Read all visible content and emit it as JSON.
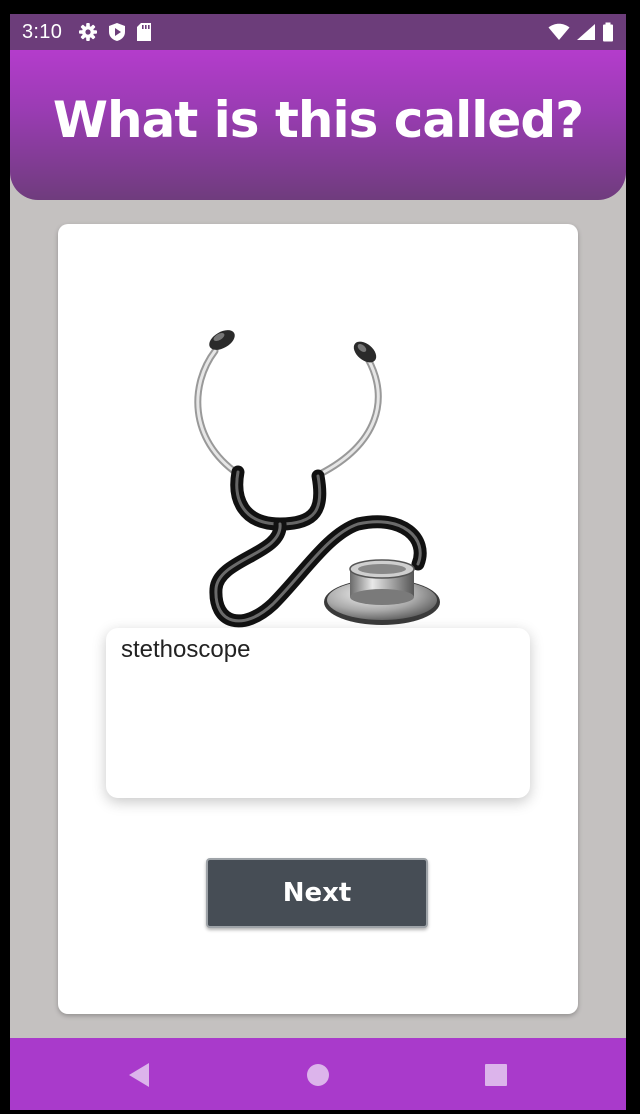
{
  "status_bar": {
    "time": "3:10",
    "left_icons": [
      "gear-icon",
      "shield-icon",
      "sd-card-icon"
    ],
    "right_icons": [
      "wifi-icon",
      "signal-icon",
      "battery-icon"
    ]
  },
  "header": {
    "title": "What is this called?"
  },
  "quiz": {
    "image": "stethoscope-illustration",
    "answer": "stethoscope",
    "next_label": "Next"
  },
  "nav_bar": {
    "buttons": [
      "back-icon",
      "home-icon",
      "recents-icon"
    ]
  },
  "colors": {
    "status_bar": "#6c3d7a",
    "header_top": "#b43ccc",
    "header_bottom": "#6f3c7d",
    "background": "#c4c1c0",
    "button": "#464d55",
    "nav_bar": "#a93acb"
  }
}
